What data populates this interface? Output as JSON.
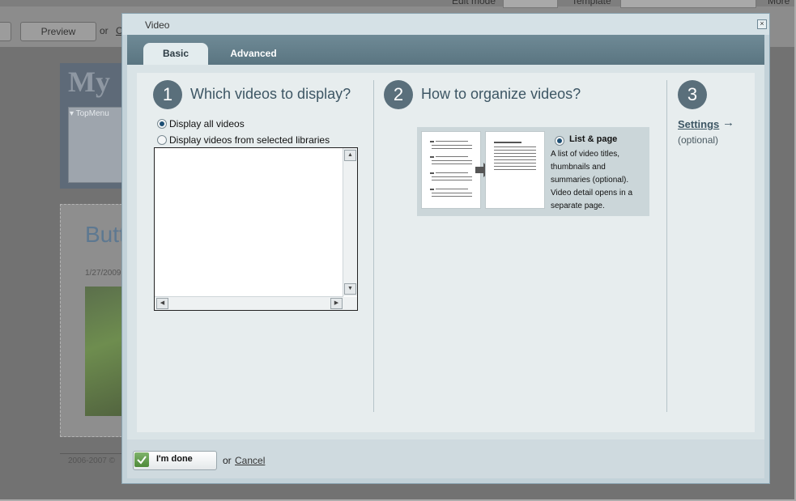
{
  "background": {
    "edit_mode_label": "Edit mode",
    "template_label": "Template",
    "more_label": "More",
    "preview_button": "Preview",
    "or": "or",
    "c_link": "C",
    "logo_text": "My",
    "top_menu": "▾ TopMenu",
    "post_title": "Butt",
    "post_date": "1/27/2009",
    "footer": "2006-2007 ©"
  },
  "dialog": {
    "title": "Video",
    "tabs": [
      {
        "label": "Basic",
        "active": true
      },
      {
        "label": "Advanced",
        "active": false
      }
    ],
    "step1": {
      "number": "1",
      "title": "Which videos to display?",
      "options": [
        {
          "label": "Display all videos",
          "selected": true
        },
        {
          "label": "Display videos from selected libraries",
          "selected": false
        }
      ]
    },
    "step2": {
      "number": "2",
      "title": "How to organize videos?",
      "option_label": "List & page",
      "option_selected": true,
      "description": "A list of video titles, thumbnails and summaries (optional). Video detail opens in a separate page."
    },
    "step3": {
      "number": "3",
      "link": "Settings",
      "arrow": "→",
      "note": "(optional)"
    },
    "footer": {
      "done_label": "I'm done",
      "or": "or",
      "cancel_label": "Cancel"
    }
  },
  "colors": {
    "accent": "#5a6f7b",
    "tabbar": "#6f8a96",
    "step_text": "#3d5664"
  }
}
